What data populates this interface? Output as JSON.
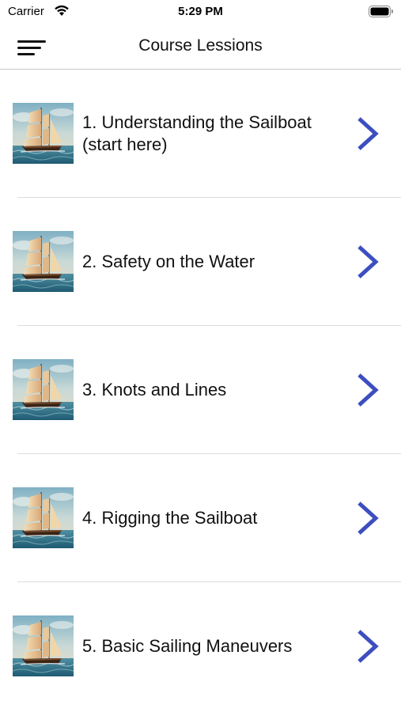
{
  "status_bar": {
    "carrier": "Carrier",
    "time": "5:29 PM"
  },
  "nav": {
    "title": "Course Lessions"
  },
  "colors": {
    "chevron": "#3d4ec0",
    "divider": "#dcdcdc"
  },
  "lessons": [
    {
      "number": "1.",
      "title": "Understanding the Sailboat (start here)"
    },
    {
      "number": "2.",
      "title": "Safety on the Water"
    },
    {
      "number": "3.",
      "title": "Knots and Lines"
    },
    {
      "number": "4.",
      "title": "Rigging the Sailboat"
    },
    {
      "number": "5.",
      "title": "Basic Sailing Maneuvers"
    }
  ],
  "thumbnail_icon": "sailboat-painting-icon",
  "row_icon": "chevron-right-icon"
}
